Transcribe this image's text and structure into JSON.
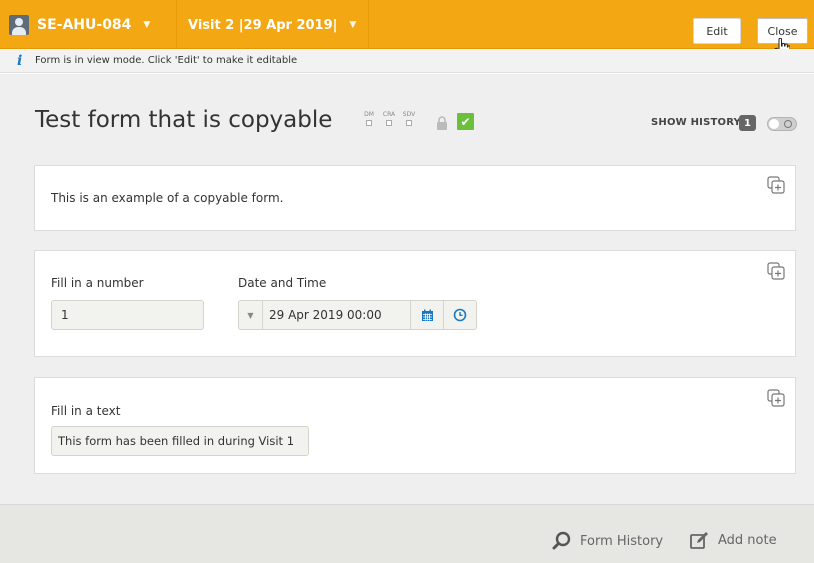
{
  "header": {
    "subject_label": "SE-AHU-084",
    "visit_label": "Visit 2 |29 Apr 2019|",
    "edit_label": "Edit",
    "close_label": "Close"
  },
  "infobar": {
    "text": "Form is in view mode. Click 'Edit' to make it editable"
  },
  "form": {
    "title": "Test form that is copyable",
    "flags": [
      "DM",
      "CRA",
      "SDV"
    ],
    "show_history_label": "SHOW HISTORY",
    "history_count": "1"
  },
  "cards": {
    "intro_text": "This is an example of a copyable form.",
    "number_label": "Fill in a number",
    "number_value": "1",
    "datetime_label": "Date and Time",
    "datetime_value": "29 Apr 2019 00:00",
    "text_label": "Fill in a text",
    "text_value": "This form has been filled in during Visit 1"
  },
  "footer": {
    "form_history_label": "Form History",
    "add_note_label": "Add note"
  },
  "colors": {
    "header_orange": "#f3a712",
    "check_green": "#6bbf3a",
    "icon_blue": "#1c78c0"
  }
}
